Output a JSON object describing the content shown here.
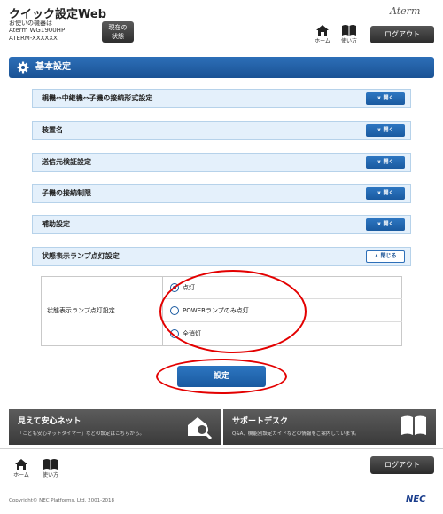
{
  "header": {
    "app_title": "クイック設定Web",
    "device_caption": "お使いの機器は",
    "device_model": "Aterm WG1900HP",
    "device_name": "ATERM-XXXXXX",
    "status_button": [
      "現在の",
      "状態"
    ],
    "brand": "Aterm",
    "home_label": "ホーム",
    "manual_label": "使い方",
    "logout_label": "ログアウト"
  },
  "section": {
    "title": "基本設定"
  },
  "accordion": {
    "items": [
      {
        "label": "親機⇔中継機⇔子機の接続形式設定",
        "button": "開く"
      },
      {
        "label": "装置名",
        "button": "開く"
      },
      {
        "label": "送信元検証設定",
        "button": "開く"
      },
      {
        "label": "子機の接続制限",
        "button": "開く"
      },
      {
        "label": "補助設定",
        "button": "開く"
      },
      {
        "label": "状態表示ランプ点灯設定",
        "button": "閉じる"
      }
    ]
  },
  "lamp_setting": {
    "label": "状態表示ランプ点灯設定",
    "options": [
      "点灯",
      "POWERランプのみ点灯",
      "全消灯"
    ],
    "selected": "点灯"
  },
  "submit_label": "設定",
  "banners": [
    {
      "title": "見えて安心ネット",
      "subtitle": "「こども安心ネットタイマー」などの設定はこちらから。",
      "icon": "house-search-icon"
    },
    {
      "title": "サポートデスク",
      "subtitle": "Q&A、機能別設定ガイドなどの情報をご案内しています。",
      "icon": "book-icon"
    }
  ],
  "footer": {
    "home_label": "ホーム",
    "manual_label": "使い方",
    "logout_label": "ログアウト",
    "copyright": "Copyright© NEC Platforms, Ltd. 2001-2018",
    "logo": "NEC"
  },
  "colors": {
    "primary_blue": "#1a5aa0",
    "row_background": "#e4f0fb",
    "annotation_red": "#e30000",
    "banner_gray": "#4a4a4a"
  }
}
